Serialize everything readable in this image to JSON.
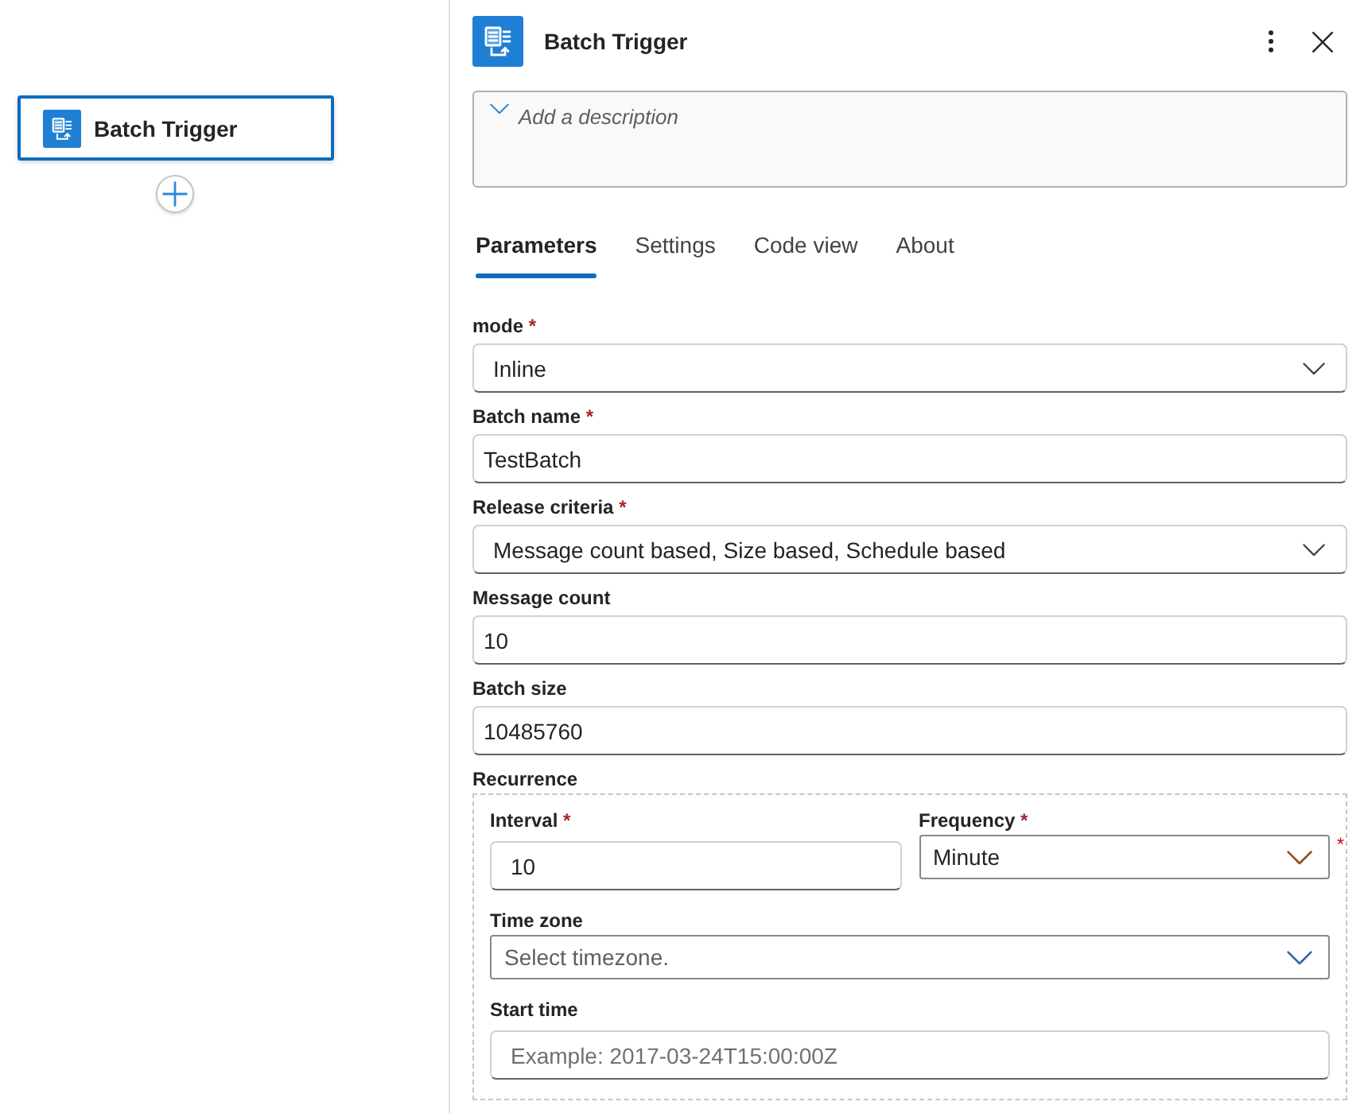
{
  "canvas": {
    "node": {
      "title": "Batch Trigger",
      "selected": true
    }
  },
  "panel": {
    "title": "Batch Trigger",
    "description": {
      "placeholder": "Add a description"
    }
  },
  "tabs": [
    {
      "label": "Parameters",
      "selected": true
    },
    {
      "label": "Settings",
      "selected": false
    },
    {
      "label": "Code view",
      "selected": false
    },
    {
      "label": "About",
      "selected": false
    }
  ],
  "fields": [
    {
      "kind": "dropdown",
      "label": "mode",
      "required_mark": "*",
      "value": "Inline"
    },
    {
      "kind": "text",
      "label": "Batch name",
      "required_mark": "*",
      "value": "TestBatch"
    },
    {
      "kind": "dropdown",
      "label": "Release criteria",
      "required_mark": "*",
      "value": "Message count based, Size based, Schedule based"
    },
    {
      "kind": "text",
      "label": "Message count",
      "value": "10"
    },
    {
      "kind": "text",
      "label": "Batch size",
      "value": "10485760"
    }
  ],
  "recurrence": {
    "label": "Recurrence",
    "rows": [
      [
        {
          "kind": "text",
          "label": "Interval",
          "required_mark": "*",
          "value": "10"
        },
        {
          "kind": "select",
          "label": "Frequency",
          "required_mark": "*",
          "value": "Minute",
          "side_mark": "*"
        }
      ],
      [
        {
          "kind": "select",
          "label": "Time zone",
          "placeholder": "Select timezone."
        }
      ],
      [
        {
          "kind": "text",
          "label": "Start time",
          "placeholder": "Example: 2017-03-24T15:00:00Z"
        }
      ]
    ]
  }
}
